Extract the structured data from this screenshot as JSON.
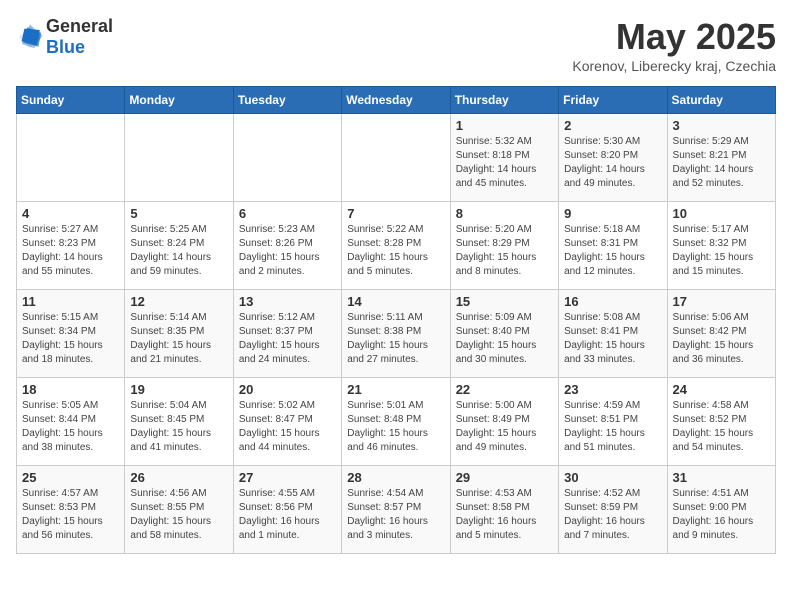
{
  "header": {
    "logo_general": "General",
    "logo_blue": "Blue",
    "title": "May 2025",
    "subtitle": "Korenov, Liberecky kraj, Czechia"
  },
  "weekdays": [
    "Sunday",
    "Monday",
    "Tuesday",
    "Wednesday",
    "Thursday",
    "Friday",
    "Saturday"
  ],
  "weeks": [
    [
      {
        "day": "",
        "info": ""
      },
      {
        "day": "",
        "info": ""
      },
      {
        "day": "",
        "info": ""
      },
      {
        "day": "",
        "info": ""
      },
      {
        "day": "1",
        "info": "Sunrise: 5:32 AM\nSunset: 8:18 PM\nDaylight: 14 hours\nand 45 minutes."
      },
      {
        "day": "2",
        "info": "Sunrise: 5:30 AM\nSunset: 8:20 PM\nDaylight: 14 hours\nand 49 minutes."
      },
      {
        "day": "3",
        "info": "Sunrise: 5:29 AM\nSunset: 8:21 PM\nDaylight: 14 hours\nand 52 minutes."
      }
    ],
    [
      {
        "day": "4",
        "info": "Sunrise: 5:27 AM\nSunset: 8:23 PM\nDaylight: 14 hours\nand 55 minutes."
      },
      {
        "day": "5",
        "info": "Sunrise: 5:25 AM\nSunset: 8:24 PM\nDaylight: 14 hours\nand 59 minutes."
      },
      {
        "day": "6",
        "info": "Sunrise: 5:23 AM\nSunset: 8:26 PM\nDaylight: 15 hours\nand 2 minutes."
      },
      {
        "day": "7",
        "info": "Sunrise: 5:22 AM\nSunset: 8:28 PM\nDaylight: 15 hours\nand 5 minutes."
      },
      {
        "day": "8",
        "info": "Sunrise: 5:20 AM\nSunset: 8:29 PM\nDaylight: 15 hours\nand 8 minutes."
      },
      {
        "day": "9",
        "info": "Sunrise: 5:18 AM\nSunset: 8:31 PM\nDaylight: 15 hours\nand 12 minutes."
      },
      {
        "day": "10",
        "info": "Sunrise: 5:17 AM\nSunset: 8:32 PM\nDaylight: 15 hours\nand 15 minutes."
      }
    ],
    [
      {
        "day": "11",
        "info": "Sunrise: 5:15 AM\nSunset: 8:34 PM\nDaylight: 15 hours\nand 18 minutes."
      },
      {
        "day": "12",
        "info": "Sunrise: 5:14 AM\nSunset: 8:35 PM\nDaylight: 15 hours\nand 21 minutes."
      },
      {
        "day": "13",
        "info": "Sunrise: 5:12 AM\nSunset: 8:37 PM\nDaylight: 15 hours\nand 24 minutes."
      },
      {
        "day": "14",
        "info": "Sunrise: 5:11 AM\nSunset: 8:38 PM\nDaylight: 15 hours\nand 27 minutes."
      },
      {
        "day": "15",
        "info": "Sunrise: 5:09 AM\nSunset: 8:40 PM\nDaylight: 15 hours\nand 30 minutes."
      },
      {
        "day": "16",
        "info": "Sunrise: 5:08 AM\nSunset: 8:41 PM\nDaylight: 15 hours\nand 33 minutes."
      },
      {
        "day": "17",
        "info": "Sunrise: 5:06 AM\nSunset: 8:42 PM\nDaylight: 15 hours\nand 36 minutes."
      }
    ],
    [
      {
        "day": "18",
        "info": "Sunrise: 5:05 AM\nSunset: 8:44 PM\nDaylight: 15 hours\nand 38 minutes."
      },
      {
        "day": "19",
        "info": "Sunrise: 5:04 AM\nSunset: 8:45 PM\nDaylight: 15 hours\nand 41 minutes."
      },
      {
        "day": "20",
        "info": "Sunrise: 5:02 AM\nSunset: 8:47 PM\nDaylight: 15 hours\nand 44 minutes."
      },
      {
        "day": "21",
        "info": "Sunrise: 5:01 AM\nSunset: 8:48 PM\nDaylight: 15 hours\nand 46 minutes."
      },
      {
        "day": "22",
        "info": "Sunrise: 5:00 AM\nSunset: 8:49 PM\nDaylight: 15 hours\nand 49 minutes."
      },
      {
        "day": "23",
        "info": "Sunrise: 4:59 AM\nSunset: 8:51 PM\nDaylight: 15 hours\nand 51 minutes."
      },
      {
        "day": "24",
        "info": "Sunrise: 4:58 AM\nSunset: 8:52 PM\nDaylight: 15 hours\nand 54 minutes."
      }
    ],
    [
      {
        "day": "25",
        "info": "Sunrise: 4:57 AM\nSunset: 8:53 PM\nDaylight: 15 hours\nand 56 minutes."
      },
      {
        "day": "26",
        "info": "Sunrise: 4:56 AM\nSunset: 8:55 PM\nDaylight: 15 hours\nand 58 minutes."
      },
      {
        "day": "27",
        "info": "Sunrise: 4:55 AM\nSunset: 8:56 PM\nDaylight: 16 hours\nand 1 minute."
      },
      {
        "day": "28",
        "info": "Sunrise: 4:54 AM\nSunset: 8:57 PM\nDaylight: 16 hours\nand 3 minutes."
      },
      {
        "day": "29",
        "info": "Sunrise: 4:53 AM\nSunset: 8:58 PM\nDaylight: 16 hours\nand 5 minutes."
      },
      {
        "day": "30",
        "info": "Sunrise: 4:52 AM\nSunset: 8:59 PM\nDaylight: 16 hours\nand 7 minutes."
      },
      {
        "day": "31",
        "info": "Sunrise: 4:51 AM\nSunset: 9:00 PM\nDaylight: 16 hours\nand 9 minutes."
      }
    ]
  ]
}
